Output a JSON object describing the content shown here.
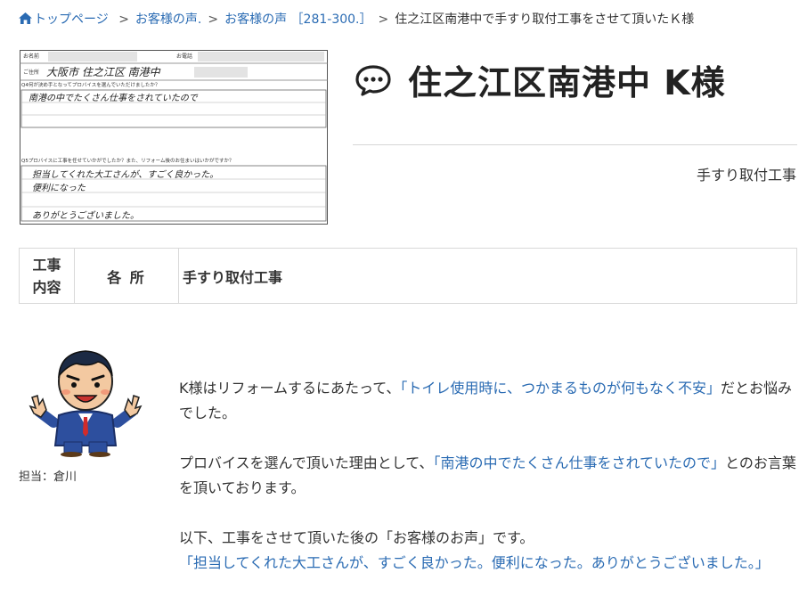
{
  "breadcrumb": {
    "home": "トップページ",
    "voice": "お客様の声.",
    "range": "お客様の声 ［281-300.］",
    "current": "住之江区南港中で手すり取付工事をさせて頂いたＫ様",
    "separator": ">"
  },
  "title": "住之江区南港中 K様",
  "work_type": "手すり取付工事",
  "info_table": {
    "header": "工事内容",
    "header_line1": "工事",
    "header_line2": "内容",
    "place": "各 所",
    "value": "手すり取付工事"
  },
  "survey_sheet": {
    "field_name": "お名前",
    "field_phone": "お電話",
    "field_address": "ご住所",
    "address_hand": "大阪市 住之江区 南港中",
    "q4": "Q4何が決め手となってプロバイスを選んでいただけましたか？",
    "q4_answer": "南港の中でたくさん仕事をされていたので",
    "q5": "Q5プロバイスに工事を任せていかがでしたか？また、リフォーム後のお住まいはいかがですか？",
    "q5_answer1": "担当してくれた大工さんが、すごく良かった。",
    "q5_answer2": "便利になった",
    "q5_answer3": "ありがとうございました。"
  },
  "staff": {
    "label": "担当：倉川"
  },
  "body": {
    "p1_pre": "K様はリフォームするにあたって、",
    "p1_hl": "「トイレ使用時に、つかまるものが何もなく不安」",
    "p1_post": "だとお悩みでした。",
    "p2_pre": "プロバイスを選んで頂いた理由として、",
    "p2_hl": "「南港の中でたくさん仕事をされていたので」",
    "p2_post": "とのお言葉を頂いております。",
    "p3_pre": "以下、工事をさせて頂いた後の「お客様のお声」です。",
    "p3_hl": "「担当してくれた大工さんが、すごく良かった。便利になった。ありがとうございました。」"
  },
  "colors": {
    "link": "#2a6bb3",
    "text": "#333333",
    "title": "#222222",
    "border": "#d9d9d9"
  },
  "icons": [
    "home-icon",
    "chat-bubble-icon"
  ]
}
